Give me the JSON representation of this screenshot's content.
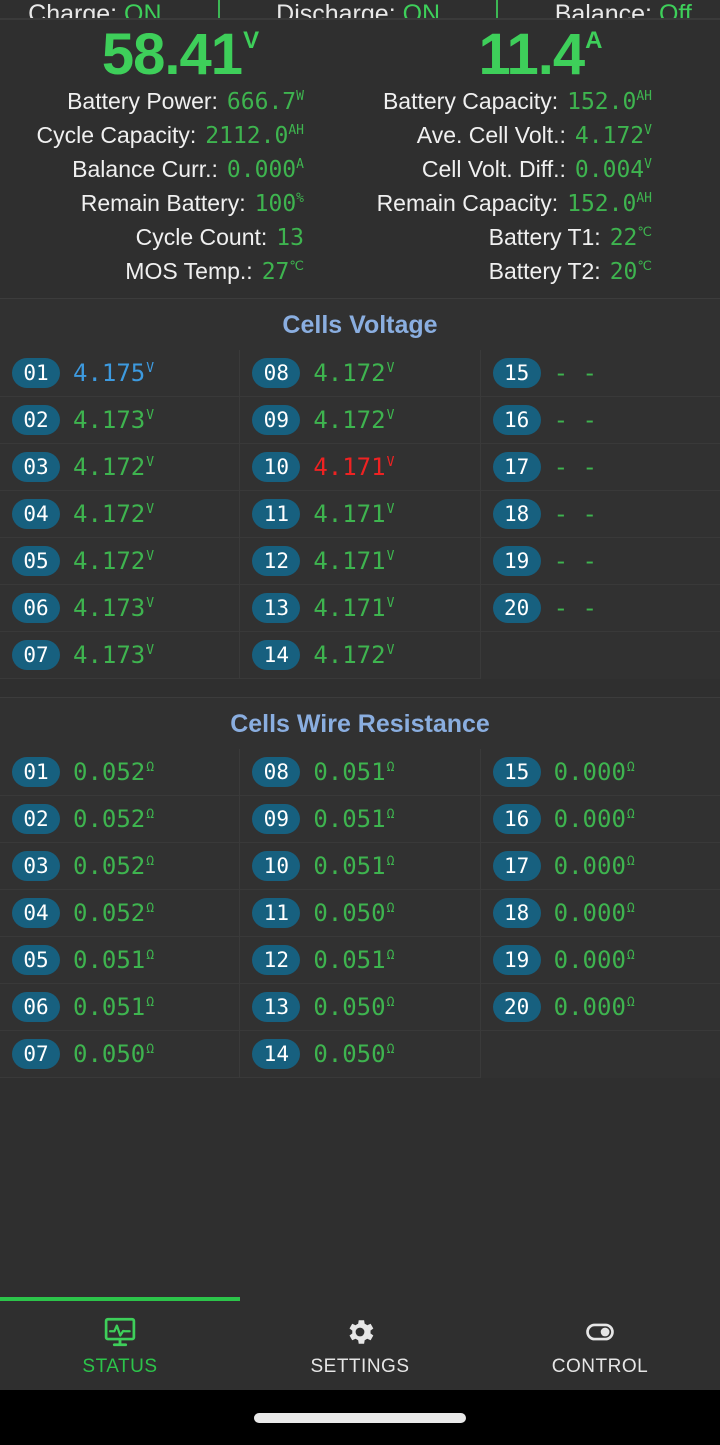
{
  "mosfet": {
    "charge_label": "Charge:",
    "charge_value": "ON",
    "discharge_label": "Discharge:",
    "discharge_value": "ON",
    "balance_label": "Balance:",
    "balance_value": "Off"
  },
  "readouts": {
    "voltage": {
      "value": "58.41",
      "unit": "V"
    },
    "current": {
      "value": "11.4",
      "unit": "A"
    }
  },
  "stats_left": [
    {
      "label": "Battery Power:",
      "value": "666.7",
      "unit": "W"
    },
    {
      "label": "Cycle Capacity:",
      "value": "2112.0",
      "unit": "AH"
    },
    {
      "label": "Balance Curr.:",
      "value": "0.000",
      "unit": "A"
    },
    {
      "label": "Remain Battery:",
      "value": "100",
      "unit": "%"
    },
    {
      "label": "Cycle Count:",
      "value": "13",
      "unit": ""
    },
    {
      "label": "MOS Temp.:",
      "value": "27",
      "unit": "℃"
    }
  ],
  "stats_right": [
    {
      "label": "Battery Capacity:",
      "value": "152.0",
      "unit": "AH"
    },
    {
      "label": "Ave. Cell Volt.:",
      "value": "4.172",
      "unit": "V"
    },
    {
      "label": "Cell Volt. Diff.:",
      "value": "0.004",
      "unit": "V"
    },
    {
      "label": "Remain Capacity:",
      "value": "152.0",
      "unit": "AH"
    },
    {
      "label": "Battery T1:",
      "value": "22",
      "unit": "℃"
    },
    {
      "label": "Battery T2:",
      "value": "20",
      "unit": "℃"
    }
  ],
  "cells_voltage": {
    "title": "Cells Voltage",
    "columns": [
      [
        {
          "id": "01",
          "value": "4.175",
          "unit": "V",
          "state": "high"
        },
        {
          "id": "02",
          "value": "4.173",
          "unit": "V",
          "state": "normal"
        },
        {
          "id": "03",
          "value": "4.172",
          "unit": "V",
          "state": "normal"
        },
        {
          "id": "04",
          "value": "4.172",
          "unit": "V",
          "state": "normal"
        },
        {
          "id": "05",
          "value": "4.172",
          "unit": "V",
          "state": "normal"
        },
        {
          "id": "06",
          "value": "4.173",
          "unit": "V",
          "state": "normal"
        },
        {
          "id": "07",
          "value": "4.173",
          "unit": "V",
          "state": "normal"
        }
      ],
      [
        {
          "id": "08",
          "value": "4.172",
          "unit": "V",
          "state": "normal"
        },
        {
          "id": "09",
          "value": "4.172",
          "unit": "V",
          "state": "normal"
        },
        {
          "id": "10",
          "value": "4.171",
          "unit": "V",
          "state": "low"
        },
        {
          "id": "11",
          "value": "4.171",
          "unit": "V",
          "state": "normal"
        },
        {
          "id": "12",
          "value": "4.171",
          "unit": "V",
          "state": "normal"
        },
        {
          "id": "13",
          "value": "4.171",
          "unit": "V",
          "state": "normal"
        },
        {
          "id": "14",
          "value": "4.172",
          "unit": "V",
          "state": "normal"
        }
      ],
      [
        {
          "id": "15",
          "value": "- -",
          "unit": "",
          "state": "na"
        },
        {
          "id": "16",
          "value": "- -",
          "unit": "",
          "state": "na"
        },
        {
          "id": "17",
          "value": "- -",
          "unit": "",
          "state": "na"
        },
        {
          "id": "18",
          "value": "- -",
          "unit": "",
          "state": "na"
        },
        {
          "id": "19",
          "value": "- -",
          "unit": "",
          "state": "na"
        },
        {
          "id": "20",
          "value": "- -",
          "unit": "",
          "state": "na"
        }
      ]
    ]
  },
  "cells_resistance": {
    "title": "Cells Wire Resistance",
    "columns": [
      [
        {
          "id": "01",
          "value": "0.052",
          "unit": "Ω",
          "state": "normal"
        },
        {
          "id": "02",
          "value": "0.052",
          "unit": "Ω",
          "state": "normal"
        },
        {
          "id": "03",
          "value": "0.052",
          "unit": "Ω",
          "state": "normal"
        },
        {
          "id": "04",
          "value": "0.052",
          "unit": "Ω",
          "state": "normal"
        },
        {
          "id": "05",
          "value": "0.051",
          "unit": "Ω",
          "state": "normal"
        },
        {
          "id": "06",
          "value": "0.051",
          "unit": "Ω",
          "state": "normal"
        },
        {
          "id": "07",
          "value": "0.050",
          "unit": "Ω",
          "state": "normal"
        }
      ],
      [
        {
          "id": "08",
          "value": "0.051",
          "unit": "Ω",
          "state": "normal"
        },
        {
          "id": "09",
          "value": "0.051",
          "unit": "Ω",
          "state": "normal"
        },
        {
          "id": "10",
          "value": "0.051",
          "unit": "Ω",
          "state": "normal"
        },
        {
          "id": "11",
          "value": "0.050",
          "unit": "Ω",
          "state": "normal"
        },
        {
          "id": "12",
          "value": "0.051",
          "unit": "Ω",
          "state": "normal"
        },
        {
          "id": "13",
          "value": "0.050",
          "unit": "Ω",
          "state": "normal"
        },
        {
          "id": "14",
          "value": "0.050",
          "unit": "Ω",
          "state": "normal"
        }
      ],
      [
        {
          "id": "15",
          "value": "0.000",
          "unit": "Ω",
          "state": "normal"
        },
        {
          "id": "16",
          "value": "0.000",
          "unit": "Ω",
          "state": "normal"
        },
        {
          "id": "17",
          "value": "0.000",
          "unit": "Ω",
          "state": "normal"
        },
        {
          "id": "18",
          "value": "0.000",
          "unit": "Ω",
          "state": "normal"
        },
        {
          "id": "19",
          "value": "0.000",
          "unit": "Ω",
          "state": "normal"
        },
        {
          "id": "20",
          "value": "0.000",
          "unit": "Ω",
          "state": "normal"
        }
      ]
    ]
  },
  "nav": {
    "items": [
      {
        "label": "STATUS",
        "icon": "monitor-waveform-icon",
        "active": true
      },
      {
        "label": "SETTINGS",
        "icon": "gear-icon",
        "active": false
      },
      {
        "label": "CONTROL",
        "icon": "toggle-switch-icon",
        "active": false
      }
    ]
  },
  "colors": {
    "accent_green": "#3ecf5a",
    "value_green": "#3eb44f",
    "section_title_blue": "#8aaee0",
    "badge_blue": "#17607f",
    "high_blue": "#3d9adf",
    "low_red": "#ef2222",
    "background": "#2f2f2f"
  }
}
